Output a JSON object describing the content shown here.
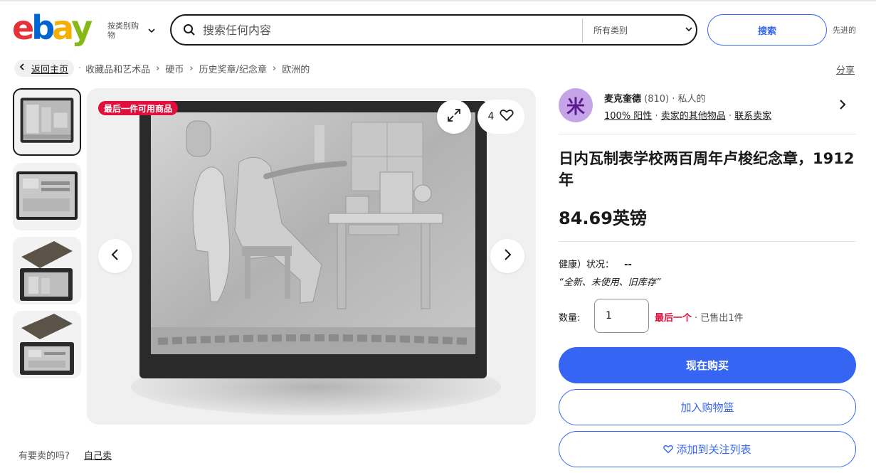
{
  "colors": {
    "accent": "#3665f3",
    "alert": "#e0103a",
    "avatar_bg": "#c5a5e8"
  },
  "header": {
    "logo": {
      "letters": [
        "e",
        "b",
        "a",
        "y"
      ],
      "colors": [
        "#e53238",
        "#0064d2",
        "#f5af02",
        "#86b817"
      ]
    },
    "category_button": "按类别购物",
    "search_placeholder": "搜索任何内容",
    "search_category": "所有类别",
    "search_button": "搜索",
    "advanced_link": "先进的"
  },
  "breadcrumb": {
    "back": "返回主页",
    "items": [
      "收藏品和艺术品",
      "硬币",
      "历史奖章/纪念章",
      "欧洲的"
    ],
    "share": "分享"
  },
  "gallery": {
    "badge": "最后一件可用商品",
    "watch_count": "4",
    "thumbnails": [
      "thumb-plaque-front",
      "thumb-plaque-reverse",
      "thumb-boxed-front",
      "thumb-boxed-reverse"
    ]
  },
  "sell": {
    "question": "有要卖的吗?",
    "link": "自己卖"
  },
  "seller": {
    "avatar_letter": "米",
    "name": "麦克奎德",
    "rating": "(810)",
    "type": "· 私人的",
    "positive": "100% 阳性",
    "other_items": "卖家的其他物品",
    "contact": "联系卖家"
  },
  "item": {
    "title": "日内瓦制表学校两百周年卢梭纪念章，1912年",
    "price": "84.69英镑",
    "condition_label": "健康）状况：",
    "condition_value": "--",
    "condition_note": "“全新、未使用、旧库存”",
    "quantity_label": "数量:",
    "quantity_value": "1",
    "quantity_last": "最后一个",
    "quantity_sold": "· 已售出1件",
    "buy_now": "现在购买",
    "add_to_cart": "加入购物篮",
    "add_to_watchlist": "添加到关注列表"
  }
}
